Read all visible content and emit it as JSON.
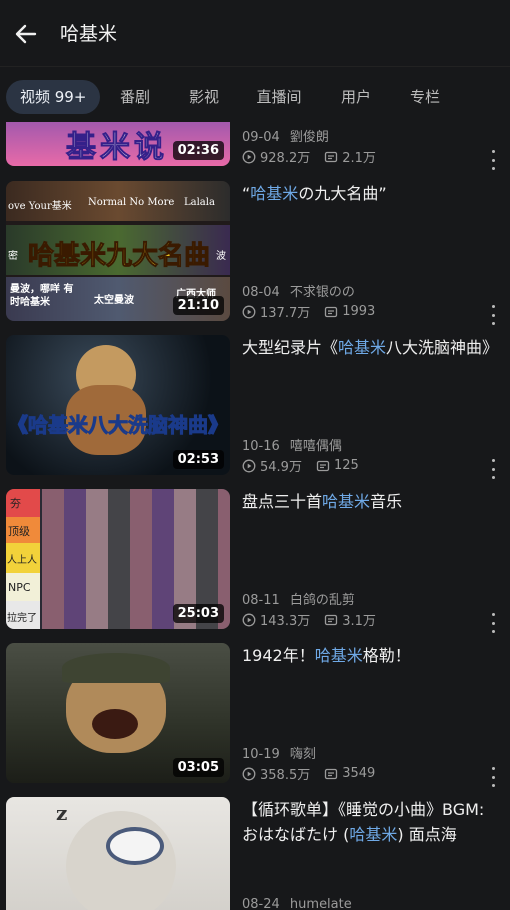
{
  "header": {
    "title": "哈基米"
  },
  "tabs": [
    {
      "label": "视频 99+"
    },
    {
      "label": "番剧"
    },
    {
      "label": "影视"
    },
    {
      "label": "直播间"
    },
    {
      "label": "用户"
    },
    {
      "label": "专栏"
    }
  ],
  "videos": [
    {
      "thumb_title": "基米说",
      "title": "",
      "date": "09-04",
      "uploader": "劉俊朗",
      "views": "928.2万",
      "danmaku": "2.1万",
      "duration": "02:36"
    },
    {
      "thumb_title": "哈基米九大名曲",
      "thumb_cells": [
        "ove Your基米",
        "Normal No More",
        "Lalala",
        "密",
        "波",
        "曼波，哪咩 有时哈基米",
        "太空曼波",
        "广西大师"
      ],
      "title_parts": [
        "“",
        "哈基米",
        "の九大名曲”"
      ],
      "date": "08-04",
      "uploader": "不求银のの",
      "views": "137.7万",
      "danmaku": "1993",
      "duration": "21:10"
    },
    {
      "thumb_title": "《哈基米八大洗脑神曲》",
      "title_parts": [
        "大型纪录片《",
        "哈基米",
        "八大洗脑神曲》"
      ],
      "date": "10-16",
      "uploader": "嘻嘻偶偶",
      "views": "54.9万",
      "danmaku": "125",
      "duration": "02:53"
    },
    {
      "tier_labels": [
        "夯",
        "顶级",
        "人上人",
        "NPC",
        "拉完了"
      ],
      "title_parts": [
        "盘点三十首",
        "哈基米",
        "音乐"
      ],
      "date": "08-11",
      "uploader": "白鸽の乱剪",
      "views": "143.3万",
      "danmaku": "3.1万",
      "duration": "25:03"
    },
    {
      "title_parts": [
        "1942年！",
        "哈基米",
        "格勒！"
      ],
      "date": "10-19",
      "uploader": "嗨刻",
      "views": "358.5万",
      "danmaku": "3549",
      "duration": "03:05"
    },
    {
      "title_parts": [
        "【循环歌单】《睡觉の小曲》BGM: おはなばたけ (",
        "哈基米",
        ") 面点海"
      ],
      "date": "08-24",
      "uploader": "humelate"
    }
  ],
  "colors": {
    "background": "#17181a",
    "highlight": "#6fa9e6",
    "active_tab": "#2b3443"
  }
}
